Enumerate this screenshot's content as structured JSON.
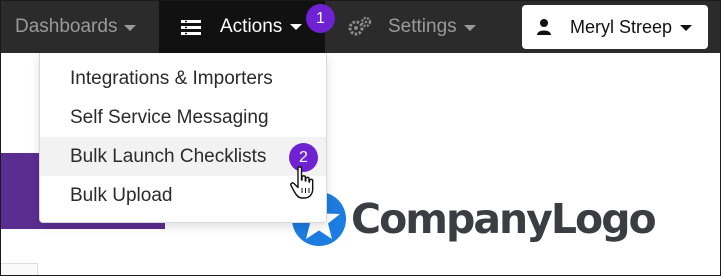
{
  "navbar": {
    "dashboards_label": "Dashboards",
    "actions_label": "Actions",
    "settings_label": "Settings",
    "user_name": "Meryl Streep"
  },
  "badges": {
    "step_1": "1",
    "step_2": "2",
    "color": "#6f22d1"
  },
  "dropdown": {
    "items": [
      {
        "label": "Integrations & Importers"
      },
      {
        "label": "Self Service Messaging"
      },
      {
        "label": "Bulk Launch Checklists"
      },
      {
        "label": "Bulk Upload"
      }
    ],
    "highlighted": "Bulk Launch Checklists"
  },
  "logo": {
    "text": "CompanyLogo",
    "accent_color": "#1c7ce0"
  },
  "colors": {
    "navbar_bg": "#2b2b2b",
    "active_nav_bg": "#111111",
    "purple_block": "#5b2d91"
  },
  "icons": {
    "actions": "hamburger-menu-icon",
    "settings": "gears-icon",
    "user": "user-icon",
    "logo": "star-circle-icon",
    "cursor": "hand-pointer-icon"
  }
}
